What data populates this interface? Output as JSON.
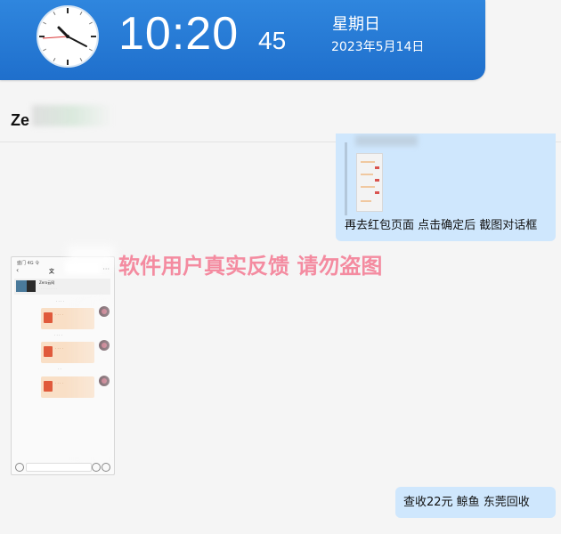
{
  "clock": {
    "time": "10:20",
    "seconds": "45",
    "weekday": "星期日",
    "date": "2023年5月14日"
  },
  "chat": {
    "contact_name": "Ze",
    "messages": [
      {
        "side": "right",
        "type": "quote",
        "text": "再去红包页面 点击确定后  截图对话框"
      },
      {
        "side": "left",
        "type": "image"
      },
      {
        "side": "right",
        "type": "text",
        "text": "查收22元    鲸鱼  东莞回收"
      }
    ]
  },
  "watermark": "软件用户真实反馈  请勿盗图",
  "screenshot": {
    "title": "文",
    "status": "盛门 4G 令",
    "top_card_text": "Zero云网"
  },
  "colors": {
    "header_blue": "#2f86de",
    "bubble_blue": "#cfe7fd",
    "watermark_pink": "#f48ba0",
    "background": "#f5f5f5"
  }
}
